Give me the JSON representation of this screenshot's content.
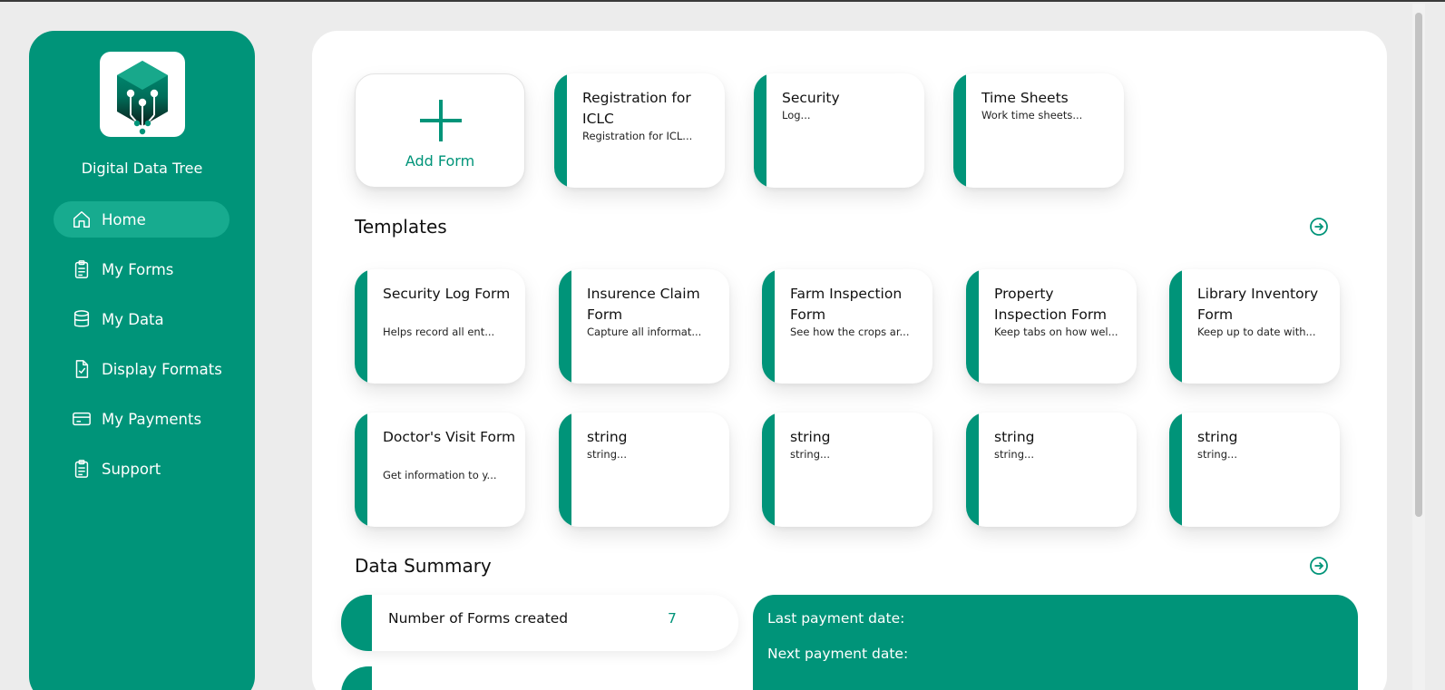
{
  "brand": {
    "name": "Digital Data Tree",
    "color": "#009479"
  },
  "nav": [
    {
      "label": "Home",
      "icon": "home-icon",
      "active": true
    },
    {
      "label": "My Forms",
      "icon": "clipboard-icon"
    },
    {
      "label": "My Data",
      "icon": "database-icon"
    },
    {
      "label": "Display Formats",
      "icon": "document-check-icon"
    },
    {
      "label": "My Payments",
      "icon": "credit-card-icon"
    },
    {
      "label": "Support",
      "icon": "clipboard-list-icon"
    }
  ],
  "forms": {
    "add_label": "Add Form",
    "items": [
      {
        "title": "Registration for ICLC",
        "desc": "Registration for ICL..."
      },
      {
        "title": "Security",
        "desc": "Log..."
      },
      {
        "title": "Time Sheets",
        "desc": "Work time sheets..."
      }
    ]
  },
  "templates": {
    "title": "Templates",
    "items": [
      {
        "title": "Security Log Form",
        "desc": "Helps record all ent..."
      },
      {
        "title": "Insurence Claim Form",
        "desc": "Capture all informat..."
      },
      {
        "title": "Farm Inspection Form",
        "desc": "See how the crops ar..."
      },
      {
        "title": "Property Inspection Form",
        "desc": "Keep tabs on how wel..."
      },
      {
        "title": "Library Inventory Form",
        "desc": "Keep up to date with..."
      },
      {
        "title": "Doctor's Visit Form",
        "desc": "Get information to y..."
      },
      {
        "title": "string",
        "desc": "string..."
      },
      {
        "title": "string",
        "desc": "string..."
      },
      {
        "title": "string",
        "desc": "string..."
      },
      {
        "title": "string",
        "desc": "string..."
      }
    ]
  },
  "summary": {
    "title": "Data Summary",
    "forms_created_label": "Number of Forms created",
    "forms_created_value": "7",
    "last_payment_label": "Last payment date:",
    "next_payment_label": "Next payment date:"
  }
}
